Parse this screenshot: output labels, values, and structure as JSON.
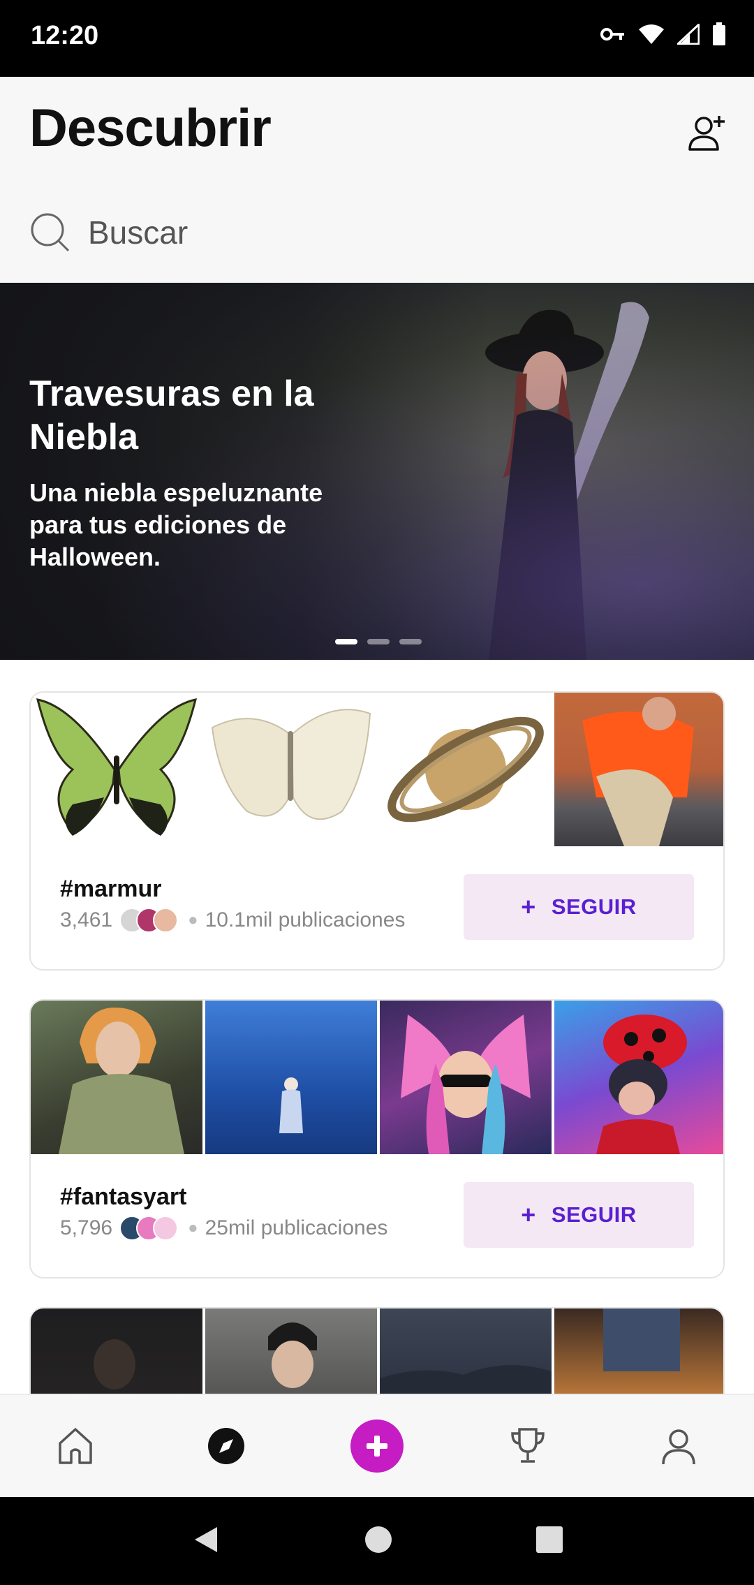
{
  "status_bar": {
    "time": "12:20",
    "icons": [
      "vpn-key-icon",
      "wifi-icon",
      "signal-icon",
      "battery-icon"
    ]
  },
  "header": {
    "title": "Descubrir",
    "add_user_icon": "add-user-icon"
  },
  "search": {
    "placeholder": "Buscar",
    "icon": "search-icon"
  },
  "banner": {
    "title": "Travesuras en la Niebla",
    "subtitle": "Una niebla espeluznante para tus ediciones de Halloween.",
    "slides": 3,
    "active_slide": 1
  },
  "hashtags": [
    {
      "tag": "#marmur",
      "followers": "3,461",
      "posts": "10.1mil publicaciones",
      "follow_label": "SEGUIR",
      "thumbnails": [
        "green-butterfly",
        "white-butterfly",
        "saturn-planet",
        "person-desert-road"
      ]
    },
    {
      "tag": "#fantasyart",
      "followers": "5,796",
      "posts": "25mil publicaciones",
      "follow_label": "SEGUIR",
      "thumbnails": [
        "armored-woman",
        "woman-blue-forest",
        "butterfly-wing-girl",
        "ladybug-helmet-girl"
      ]
    },
    {
      "tag": "",
      "followers": "",
      "posts": "",
      "follow_label": "",
      "thumbnails": [
        "dark-portrait",
        "woman-beanie",
        "night-city",
        "sneakers-street"
      ]
    }
  ],
  "bottom_nav": {
    "items": [
      "home-icon",
      "discover-compass-icon",
      "create-plus-icon",
      "trophy-icon",
      "profile-icon"
    ],
    "active": "discover-compass-icon"
  },
  "system_nav": [
    "back-icon",
    "home-circle-icon",
    "recents-icon"
  ],
  "colors": {
    "accent": "#5a1fd1",
    "follow_bg": "#f3e8f4",
    "create_button": "#c51cc4"
  }
}
